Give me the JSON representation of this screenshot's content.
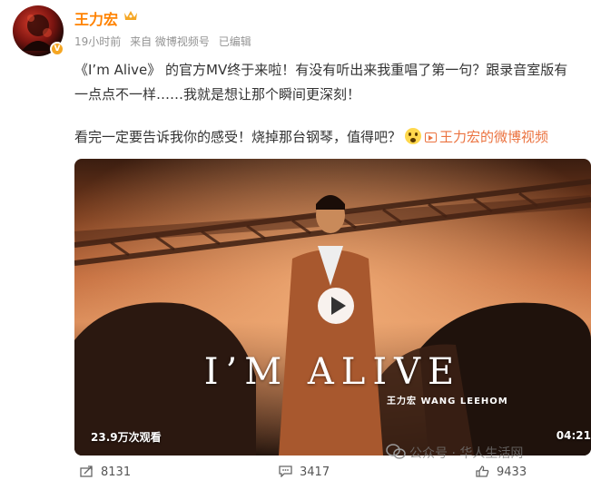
{
  "user": {
    "name": "王力宏",
    "verified_badge": "V",
    "crown_color": "#f5a623"
  },
  "meta": {
    "time": "19小时前",
    "source": "来自 微博视频号",
    "edited": "已编辑"
  },
  "post": {
    "line1": "《I’m Alive》 的官方MV终于来啦！有没有听出来我重唱了第一句？跟录音室版有",
    "line2": "一点点不一样……我就是想让那个瞬间更深刻！",
    "line3": "看完一定要告诉我你的感受！烧掉那台钢琴，值得吧？",
    "video_link": "王力宏的微博视频",
    "link_color": "#eb7340"
  },
  "video": {
    "title": "I’M ALIVE",
    "credit": "王力宏 WANG LEEHOM",
    "views": "23.9万次观看",
    "duration": "04:21"
  },
  "watermark": {
    "text": "公众号 · 华人生活网"
  },
  "actions": {
    "share_count": "8131",
    "comment_count": "3417",
    "like_count": "9433"
  }
}
